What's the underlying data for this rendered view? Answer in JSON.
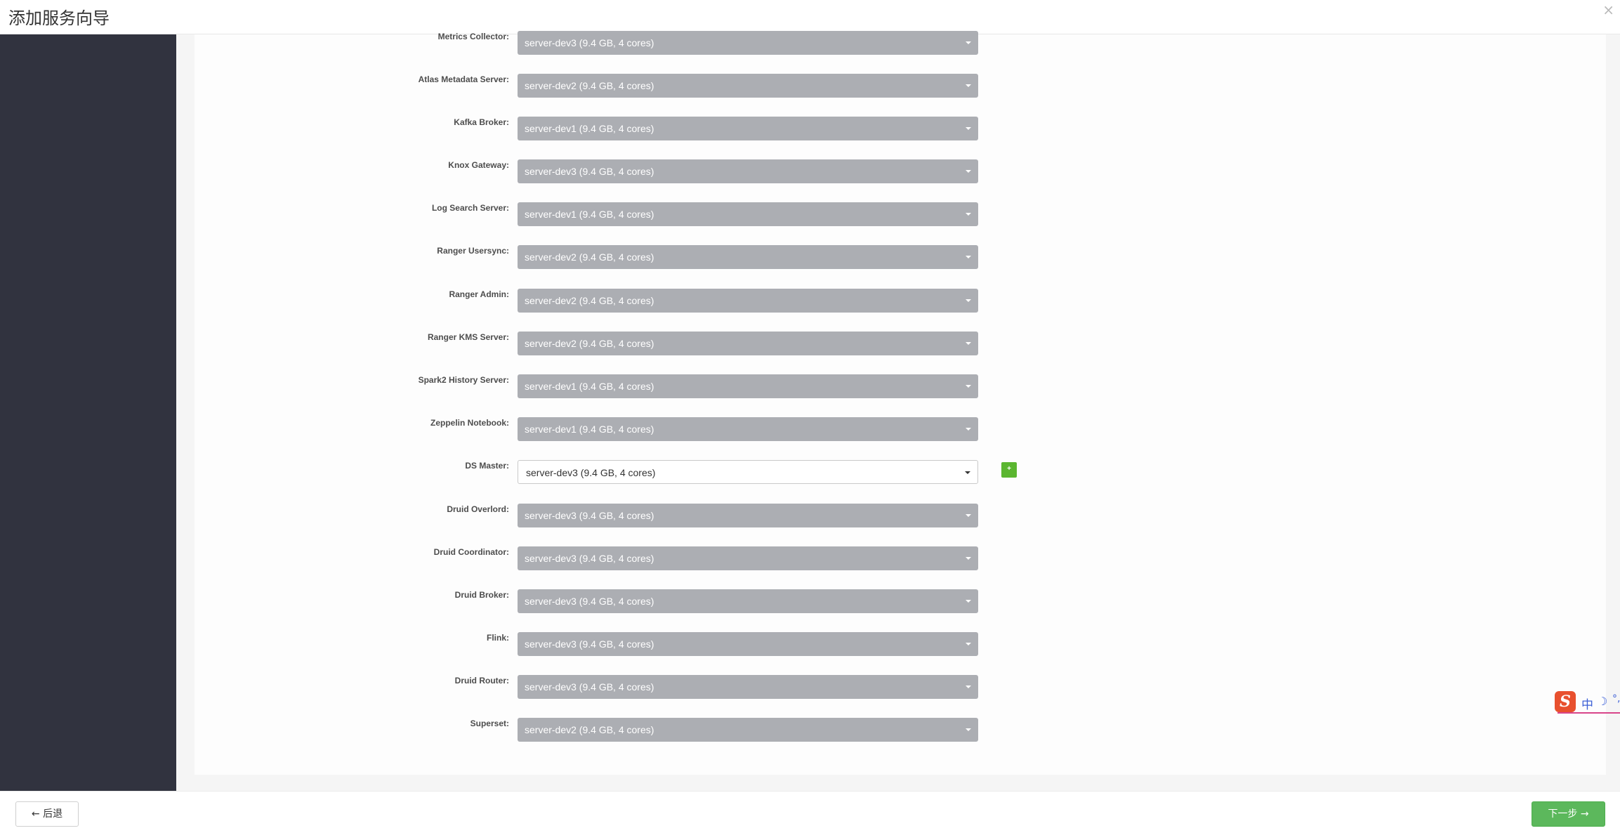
{
  "header": {
    "title": "添加服务向导",
    "close_symbol": "×"
  },
  "assignments": [
    {
      "label": "Metrics Collector:",
      "value": "server-dev3 (9.4 GB, 4 cores)"
    },
    {
      "label": "Atlas Metadata Server:",
      "value": "server-dev2 (9.4 GB, 4 cores)"
    },
    {
      "label": "Kafka Broker:",
      "value": "server-dev1 (9.4 GB, 4 cores)"
    },
    {
      "label": "Knox Gateway:",
      "value": "server-dev3 (9.4 GB, 4 cores)"
    },
    {
      "label": "Log Search Server:",
      "value": "server-dev1 (9.4 GB, 4 cores)"
    },
    {
      "label": "Ranger Usersync:",
      "value": "server-dev2 (9.4 GB, 4 cores)"
    },
    {
      "label": "Ranger Admin:",
      "value": "server-dev2 (9.4 GB, 4 cores)"
    },
    {
      "label": "Ranger KMS Server:",
      "value": "server-dev2 (9.4 GB, 4 cores)"
    },
    {
      "label": "Spark2 History Server:",
      "value": "server-dev1 (9.4 GB, 4 cores)"
    },
    {
      "label": "Zeppelin Notebook:",
      "value": "server-dev1 (9.4 GB, 4 cores)"
    },
    {
      "label": "DS Master:",
      "value": "server-dev3 (9.4 GB, 4 cores)",
      "editable": true,
      "add_symbol": "+"
    },
    {
      "label": "Druid Overlord:",
      "value": "server-dev3 (9.4 GB, 4 cores)"
    },
    {
      "label": "Druid Coordinator:",
      "value": "server-dev3 (9.4 GB, 4 cores)"
    },
    {
      "label": "Druid Broker:",
      "value": "server-dev3 (9.4 GB, 4 cores)"
    },
    {
      "label": "Flink:",
      "value": "server-dev3 (9.4 GB, 4 cores)"
    },
    {
      "label": "Druid Router:",
      "value": "server-dev3 (9.4 GB, 4 cores)"
    },
    {
      "label": "Superset:",
      "value": "server-dev2 (9.4 GB, 4 cores)"
    }
  ],
  "footer": {
    "back_label": "← 后退",
    "next_label": "下一步 →"
  },
  "ime": {
    "logo": "S",
    "mode": "中",
    "moon_symbol": "☽",
    "punct_symbol": "°,"
  },
  "colors": {
    "sidebar": "#31333f",
    "select_disabled": "#acaeb3",
    "primary_green": "#5cb85c",
    "add_green": "#5bb630"
  }
}
